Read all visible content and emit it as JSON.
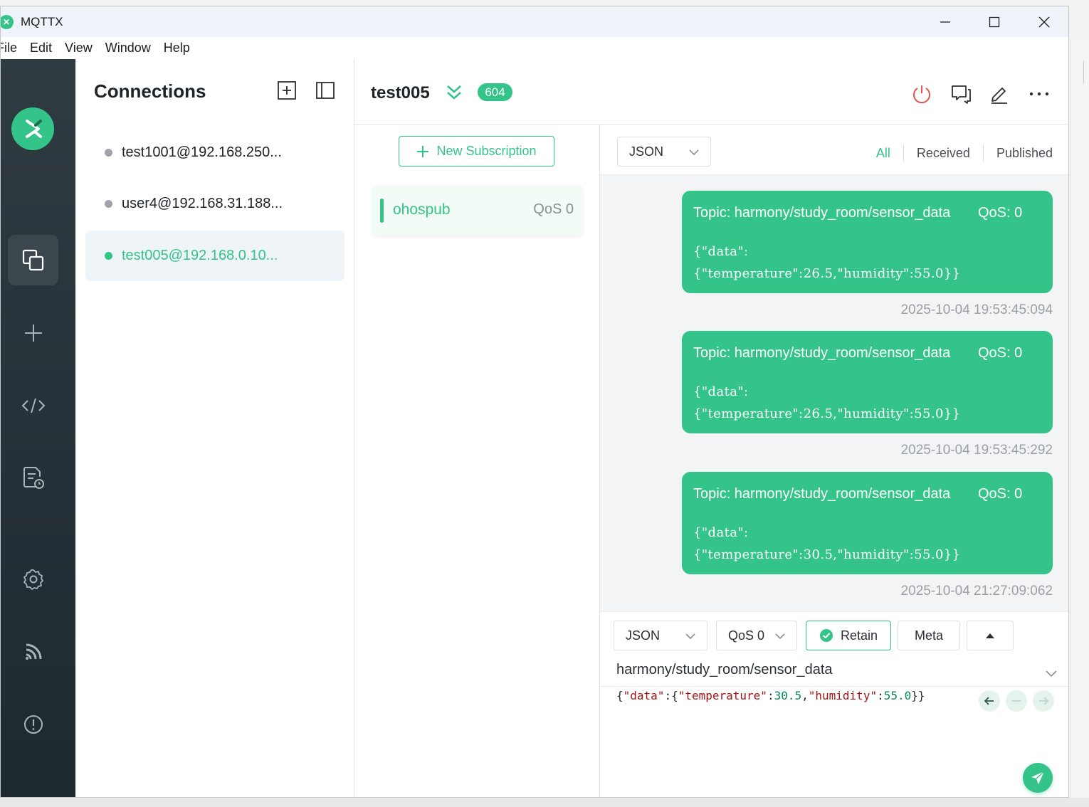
{
  "window": {
    "title": "MQTTX"
  },
  "menu": [
    "File",
    "Edit",
    "View",
    "Window",
    "Help"
  ],
  "connections": {
    "title": "Connections",
    "items": [
      {
        "label": "test1001@192.168.250...",
        "status": "offline"
      },
      {
        "label": "user4@192.168.31.188...",
        "status": "offline"
      },
      {
        "label": "test005@192.168.0.10...",
        "status": "online"
      }
    ]
  },
  "header": {
    "name": "test005",
    "count": "604"
  },
  "subscriptions": {
    "new_label": "New Subscription",
    "items": [
      {
        "topic": "ohospub",
        "qos": "QoS 0"
      }
    ]
  },
  "messages_toolbar": {
    "format": "JSON",
    "filters": [
      "All",
      "Received",
      "Published"
    ]
  },
  "messages": [
    {
      "topic": "Topic: harmony/study_room/sensor_data",
      "qos": "QoS: 0",
      "payload_line1": "{\"data\":",
      "payload_line2": "{\"temperature\":26.5,\"humidity\":55.0}}",
      "time": "2025-10-04 19:53:45:094"
    },
    {
      "topic": "Topic: harmony/study_room/sensor_data",
      "qos": "QoS: 0",
      "payload_line1": "{\"data\":",
      "payload_line2": "{\"temperature\":26.5,\"humidity\":55.0}}",
      "time": "2025-10-04 19:53:45:292"
    },
    {
      "topic": "Topic: harmony/study_room/sensor_data",
      "qos": "QoS: 0",
      "payload_line1": "{\"data\":",
      "payload_line2": "{\"temperature\":30.5,\"humidity\":55.0}}",
      "time": "2025-10-04 21:27:09:062"
    }
  ],
  "composer": {
    "format": "JSON",
    "qos": "QoS 0",
    "retain_label": "Retain",
    "meta_label": "Meta",
    "topic": "harmony/study_room/sensor_data",
    "payload": {
      "p1": "{",
      "k1": "\"data\"",
      "p2": ":{",
      "k2": "\"temperature\"",
      "p3": ":",
      "v1": "30.5",
      "p4": ",",
      "k3": "\"humidity\"",
      "p5": ":",
      "v2": "55.0",
      "p6": "}}"
    }
  },
  "colors": {
    "accent": "#34c388",
    "nav": "#2b373d",
    "offline_dot": "#a0a4a8"
  }
}
